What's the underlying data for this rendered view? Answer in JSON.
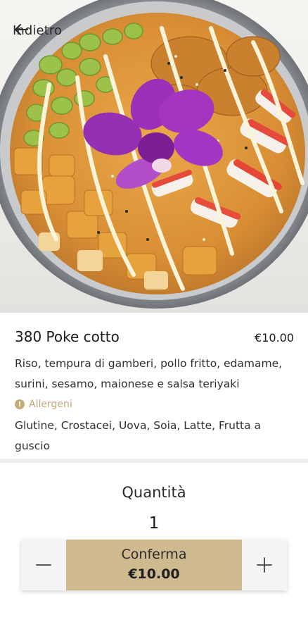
{
  "header": {
    "back_label": "Indietro",
    "back_icon": "arrow-left-icon"
  },
  "dish": {
    "title": "380 Poke cotto",
    "price": "€10.00",
    "description": "Riso, tempura di gamberi, pollo fritto, edamame, surini, sesamo, maionese e salsa teriyaki",
    "allergens_label": "Allergeni",
    "allergens_icon": "warning-icon",
    "allergens": "Glutine, Crostacei, Uova, Soia, Latte, Frutta a guscio"
  },
  "quantity": {
    "label": "Quantità",
    "value": "1",
    "decrease_icon": "minus-icon",
    "increase_icon": "plus-icon"
  },
  "confirm": {
    "label": "Conferma",
    "price": "€10.00"
  },
  "colors": {
    "accent": "#cfb98f",
    "allergen": "#c3a676",
    "separator": "#eeeeee"
  }
}
